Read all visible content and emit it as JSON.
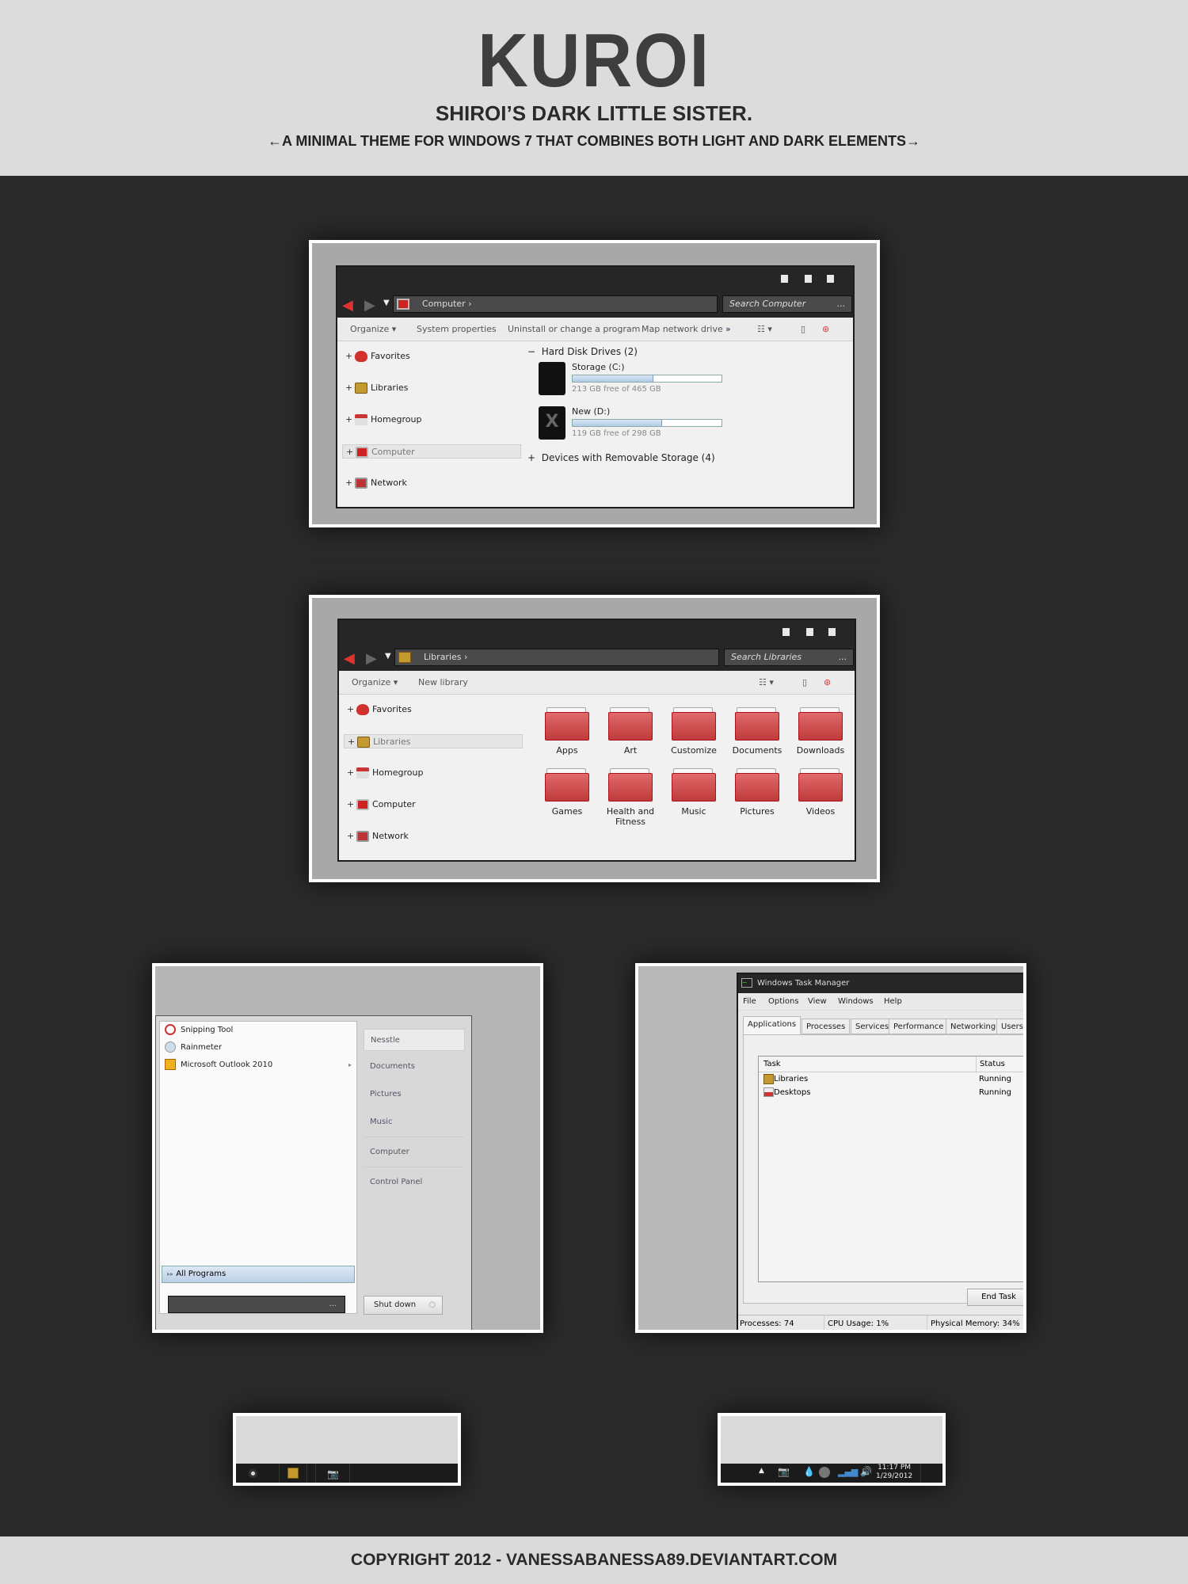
{
  "header": {
    "title": "KUROI",
    "subtitle": "SHIROI’S DARK LITTLE SISTER.",
    "tagline": "←A MINIMAL THEME FOR WINDOWS 7 THAT COMBINES BOTH LIGHT AND DARK ELEMENTS→"
  },
  "footer": {
    "copyright": "COPYRIGHT 2012 - VANESSABANESSA89.DEVIANTART.COM"
  },
  "explorer1": {
    "address": "Computer",
    "search_placeholder": "Search Computer",
    "search_more": "...",
    "commands": [
      "Organize ▾",
      "System properties",
      "Uninstall or change a program",
      "Map network drive",
      "»"
    ],
    "nav": [
      {
        "label": "Favorites",
        "icon": "heart"
      },
      {
        "label": "Libraries",
        "icon": "library"
      },
      {
        "label": "Homegroup",
        "icon": "home"
      },
      {
        "label": "Computer",
        "icon": "computer",
        "selected": true
      },
      {
        "label": "Network",
        "icon": "network"
      }
    ],
    "group1": "Hard Disk Drives (2)",
    "group1_toggle": "−",
    "drives": [
      {
        "name": "Storage (C:)",
        "info": "213 GB free of 465 GB",
        "used_fraction": 0.54,
        "mark": ""
      },
      {
        "name": "New (D:)",
        "info": "119 GB free of 298 GB",
        "used_fraction": 0.6,
        "mark": "X"
      }
    ],
    "group2": "Devices with Removable Storage (4)",
    "group2_toggle": "+"
  },
  "explorer2": {
    "address": "Libraries",
    "search_placeholder": "Search Libraries",
    "search_more": "...",
    "commands": [
      "Organize ▾",
      "New library"
    ],
    "nav": [
      {
        "label": "Favorites"
      },
      {
        "label": "Libraries",
        "selected": true
      },
      {
        "label": "Homegroup"
      },
      {
        "label": "Computer"
      },
      {
        "label": "Network"
      }
    ],
    "folders": [
      "Apps",
      "Art",
      "Customize",
      "Documents",
      "Downloads",
      "Games",
      "Health and Fitness",
      "Music",
      "Pictures",
      "Videos"
    ]
  },
  "start_menu": {
    "programs": [
      "Snipping Tool",
      "Rainmeter",
      "Microsoft Outlook 2010"
    ],
    "right": [
      "Nesstle",
      "Documents",
      "Pictures",
      "Music",
      "Computer",
      "Control Panel"
    ],
    "all_programs": "All Programs",
    "search_more": "...",
    "shutdown": "Shut down"
  },
  "task_manager": {
    "title": "Windows Task Manager",
    "menu": [
      "File",
      "Options",
      "View",
      "Windows",
      "Help"
    ],
    "tabs": [
      "Applications",
      "Processes",
      "Services",
      "Performance",
      "Networking",
      "Users"
    ],
    "columns": [
      "Task",
      "Status"
    ],
    "rows": [
      {
        "task": "Libraries",
        "status": "Running"
      },
      {
        "task": "Desktops",
        "status": "Running"
      }
    ],
    "end_task": "End Task",
    "status": {
      "processes": "Processes: 74",
      "cpu": "CPU Usage: 1%",
      "memory": "Physical Memory: 34%"
    }
  },
  "tray": {
    "time": "11:17 PM",
    "date": "1/29/2012"
  }
}
